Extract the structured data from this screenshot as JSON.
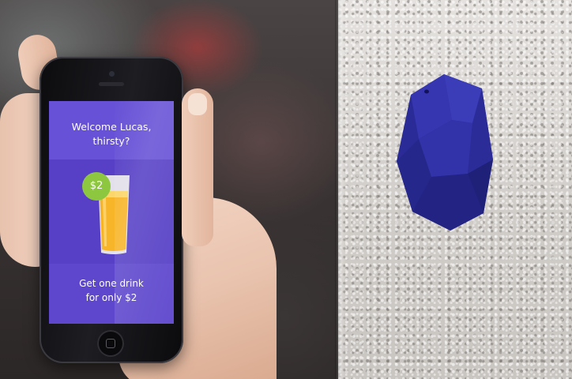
{
  "phone_screen": {
    "greeting": "Welcome Lucas,",
    "question": "thirsty?",
    "price_badge": "$2",
    "offer_line1": "Get one drink",
    "offer_line2": "for only $2"
  },
  "colors": {
    "screen_purple": "#5a43c8",
    "badge_green": "#8dc63f",
    "beacon_blue": "#2f2fa0",
    "wall": "#d9d6d3"
  },
  "icons": [
    "drink-glass-icon",
    "home-button-icon"
  ]
}
